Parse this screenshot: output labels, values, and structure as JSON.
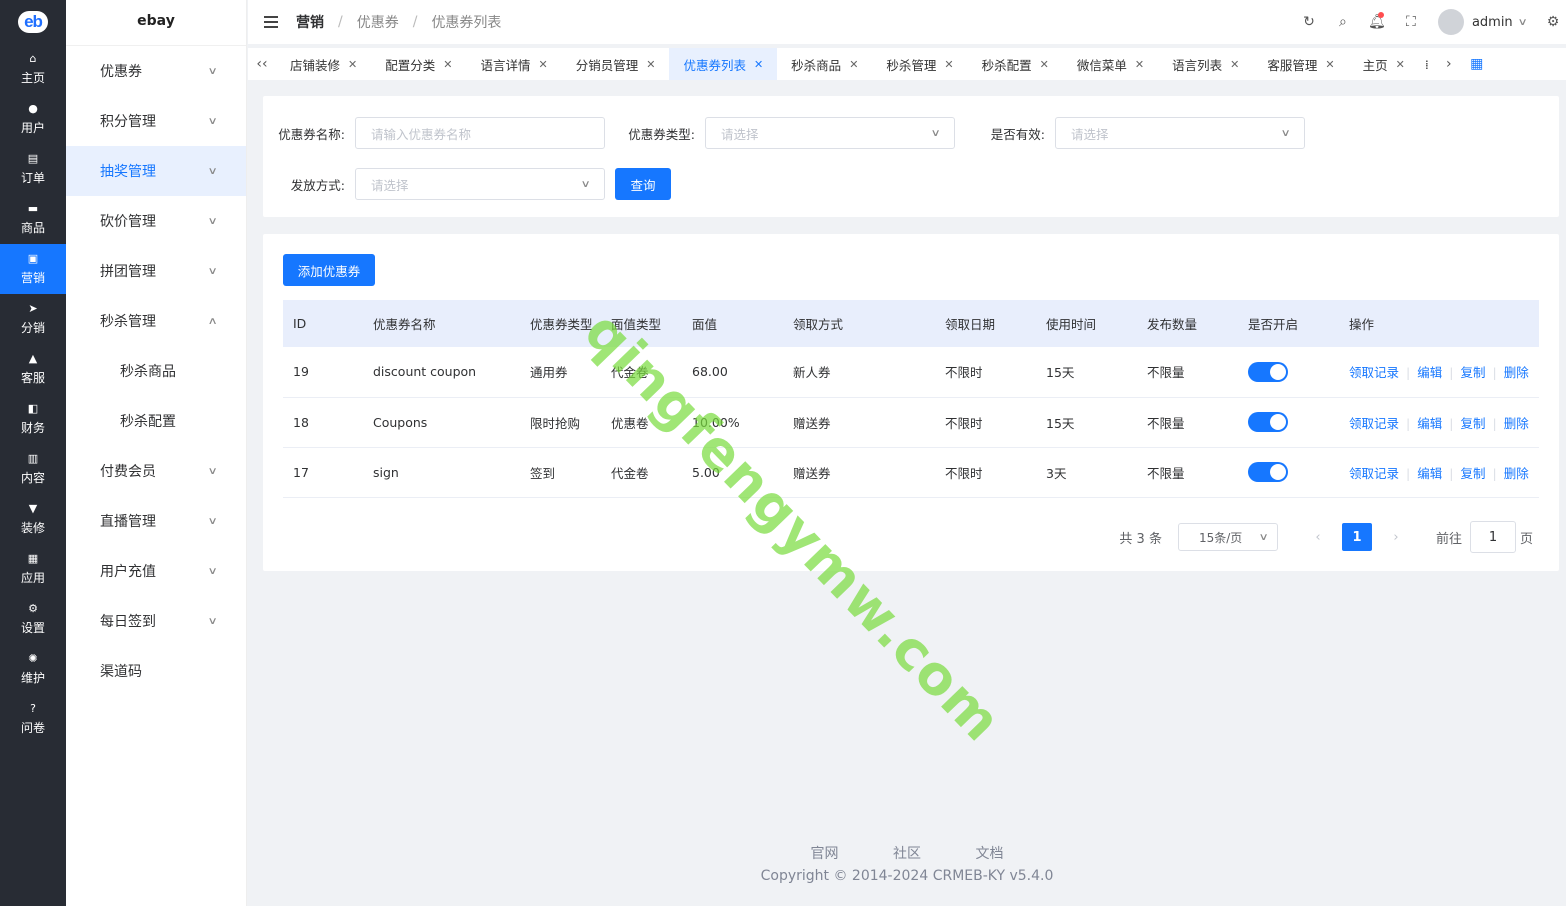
{
  "rail": {
    "items": [
      {
        "label": "主页",
        "icon": "home-icon",
        "glyph": "⌂"
      },
      {
        "label": "用户",
        "icon": "user-icon",
        "glyph": "●"
      },
      {
        "label": "订单",
        "icon": "order-icon",
        "glyph": "▤"
      },
      {
        "label": "商品",
        "icon": "goods-icon",
        "glyph": "▬"
      },
      {
        "label": "营销",
        "icon": "marketing-icon",
        "glyph": "▣"
      },
      {
        "label": "分销",
        "icon": "distribution-icon",
        "glyph": "➤"
      },
      {
        "label": "客服",
        "icon": "service-bell-icon",
        "glyph": "▲"
      },
      {
        "label": "财务",
        "icon": "finance-icon",
        "glyph": "◧"
      },
      {
        "label": "内容",
        "icon": "content-icon",
        "glyph": "▥"
      },
      {
        "label": "装修",
        "icon": "decorate-icon",
        "glyph": "▼"
      },
      {
        "label": "应用",
        "icon": "apps-grid-icon",
        "glyph": "▦"
      },
      {
        "label": "设置",
        "icon": "settings-gear-icon",
        "glyph": "⚙"
      },
      {
        "label": "维护",
        "icon": "maintenance-icon",
        "glyph": "✺"
      },
      {
        "label": "问卷",
        "icon": "question-icon",
        "glyph": "?"
      }
    ]
  },
  "submenu": {
    "title": "ebay",
    "items": [
      {
        "label": "优惠券",
        "chevron": "down"
      },
      {
        "label": "积分管理",
        "chevron": "down"
      },
      {
        "label": "抽奖管理",
        "chevron": "down"
      },
      {
        "label": "砍价管理",
        "chevron": "down"
      },
      {
        "label": "拼团管理",
        "chevron": "down"
      },
      {
        "label": "秒杀管理",
        "chevron": "up"
      },
      {
        "label": "秒杀商品",
        "chevron": ""
      },
      {
        "label": "秒杀配置",
        "chevron": ""
      },
      {
        "label": "付费会员",
        "chevron": "down"
      },
      {
        "label": "直播管理",
        "chevron": "down"
      },
      {
        "label": "用户充值",
        "chevron": "down"
      },
      {
        "label": "每日签到",
        "chevron": "down"
      },
      {
        "label": "渠道码",
        "chevron": ""
      }
    ]
  },
  "header": {
    "breadcrumb": [
      "营销",
      "优惠券",
      "优惠券列表"
    ],
    "separator": "/",
    "username": "admin"
  },
  "tabs": [
    "店铺装修",
    "配置分类",
    "语言详情",
    "分销员管理",
    "优惠券列表",
    "秒杀商品",
    "秒杀管理",
    "秒杀配置",
    "微信菜单",
    "语言列表",
    "客服管理",
    "主页"
  ],
  "filters": {
    "name_label": "优惠券名称:",
    "name_placeholder": "请输入优惠券名称",
    "type_label": "优惠券类型:",
    "type_placeholder": "请选择",
    "valid_label": "是否有效:",
    "valid_placeholder": "请选择",
    "issue_label": "发放方式:",
    "issue_placeholder": "请选择",
    "search_button": "查询"
  },
  "add_button": "添加优惠券",
  "table": {
    "columns": [
      "ID",
      "优惠券名称",
      "优惠券类型",
      "面值类型",
      "面值",
      "领取方式",
      "领取日期",
      "使用时间",
      "发布数量",
      "是否开启",
      "操作"
    ],
    "rows": [
      {
        "id": "19",
        "name": "discount coupon",
        "type": "通用券",
        "value_type": "代金卷",
        "value": "68.00",
        "receive": "新人券",
        "date": "不限时",
        "use_time": "15天",
        "count": "不限量",
        "enabled": true
      },
      {
        "id": "18",
        "name": "Coupons",
        "type": "限时抢购",
        "value_type": "优惠卷",
        "value": "10.00%",
        "receive": "赠送券",
        "date": "不限时",
        "use_time": "15天",
        "count": "不限量",
        "enabled": true
      },
      {
        "id": "17",
        "name": "sign",
        "type": "签到",
        "value_type": "代金卷",
        "value": "5.00",
        "receive": "赠送券",
        "date": "不限时",
        "use_time": "3天",
        "count": "不限量",
        "enabled": true
      }
    ],
    "actions": [
      "领取记录",
      "编辑",
      "复制",
      "删除"
    ]
  },
  "pagination": {
    "total": "共 3 条",
    "page_size": "15条/页",
    "current": "1",
    "goto_label": "前往",
    "goto_value": "1",
    "page_suffix": "页"
  },
  "footer": {
    "links": [
      "官网",
      "社区",
      "文档"
    ],
    "copyright": "Copyright © 2014-2024 CRMEB-KY v5.4.0"
  },
  "watermark": "qingfengymw.com",
  "colors": {
    "accent": "#1677ff",
    "rail": "#282c34"
  }
}
